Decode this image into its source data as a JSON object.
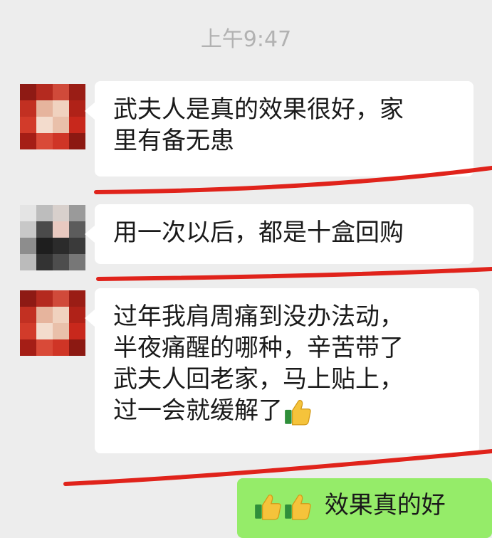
{
  "timestamp": "上午9:47",
  "messages": [
    {
      "sender": "other",
      "lines": [
        "武夫人是真的效果很好，家",
        "里有备无患"
      ]
    },
    {
      "sender": "other",
      "lines": [
        "用一次以后，都是十盒回购"
      ]
    },
    {
      "sender": "other",
      "lines": [
        "过年我肩周痛到没办法动，",
        "半夜痛醒的哪种，辛苦带了",
        "武夫人回老家，马上贴上，",
        "过一会就缓解了"
      ],
      "trailing_icon": "thumbs-up-emoji-icon"
    },
    {
      "sender": "self",
      "text": "效果真的好",
      "leading_icons": [
        "thumbs-up-emoji-icon",
        "thumbs-up-emoji-icon"
      ]
    }
  ],
  "colors": {
    "background": "#ededed",
    "bubble_other": "#ffffff",
    "bubble_self": "#95ec69",
    "timestamp_text": "#b2b2b2",
    "annotation_red": "#e0231b"
  }
}
